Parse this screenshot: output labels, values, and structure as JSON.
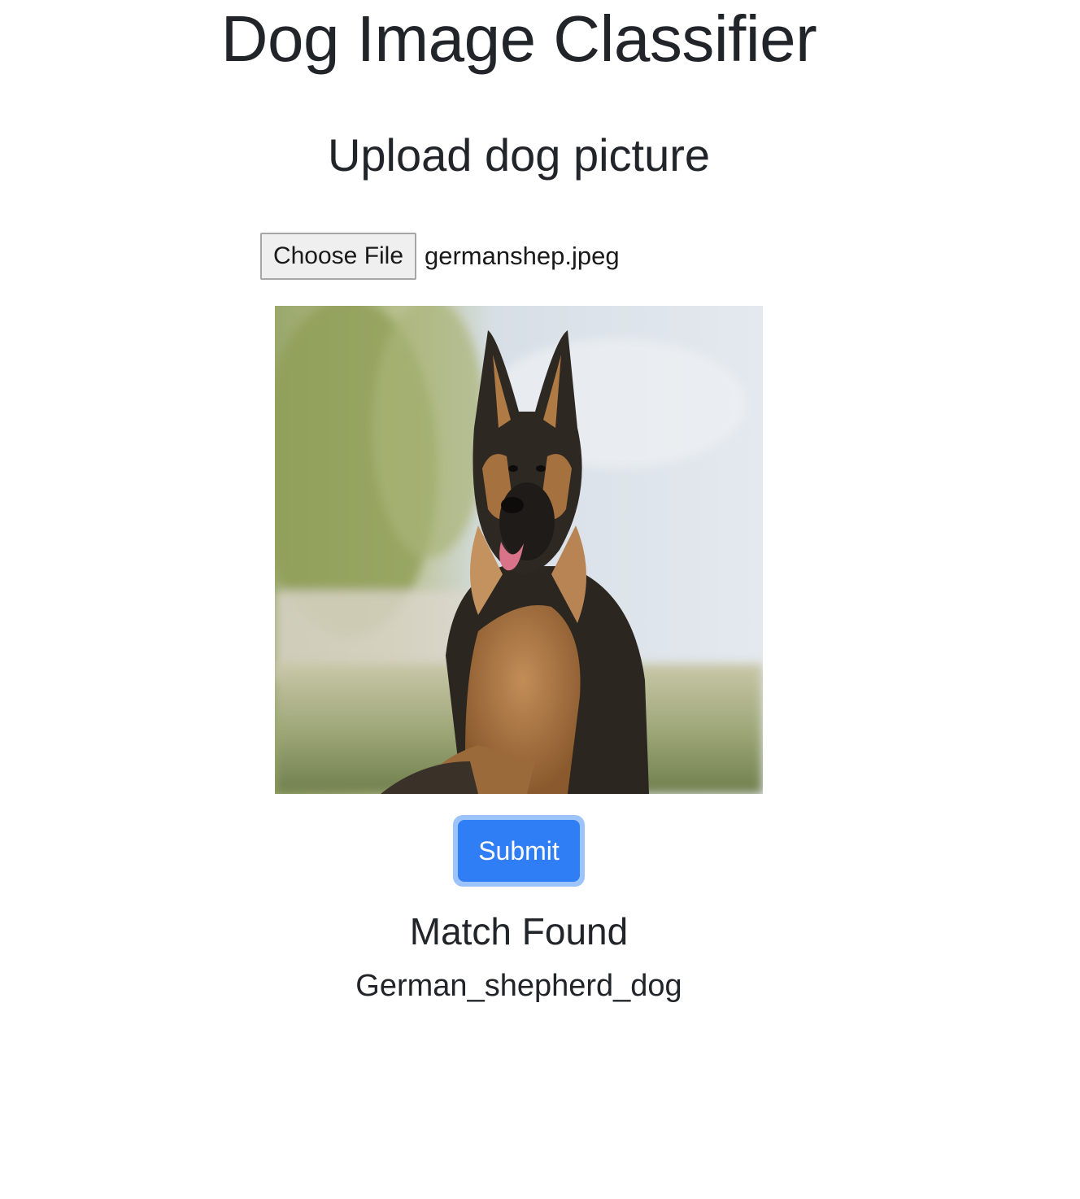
{
  "header": {
    "title": "Dog Image Classifier",
    "subtitle": "Upload dog picture"
  },
  "upload": {
    "choose_label": "Choose File",
    "file_name": "germanshep.jpeg",
    "preview_description": "German shepherd dog lying on grass"
  },
  "actions": {
    "submit_label": "Submit"
  },
  "result": {
    "status": "Match Found",
    "breed": "German_shepherd_dog"
  },
  "colors": {
    "primary": "#2f7ef6",
    "focus_ring": "#9cc4fb",
    "text": "#212529"
  }
}
